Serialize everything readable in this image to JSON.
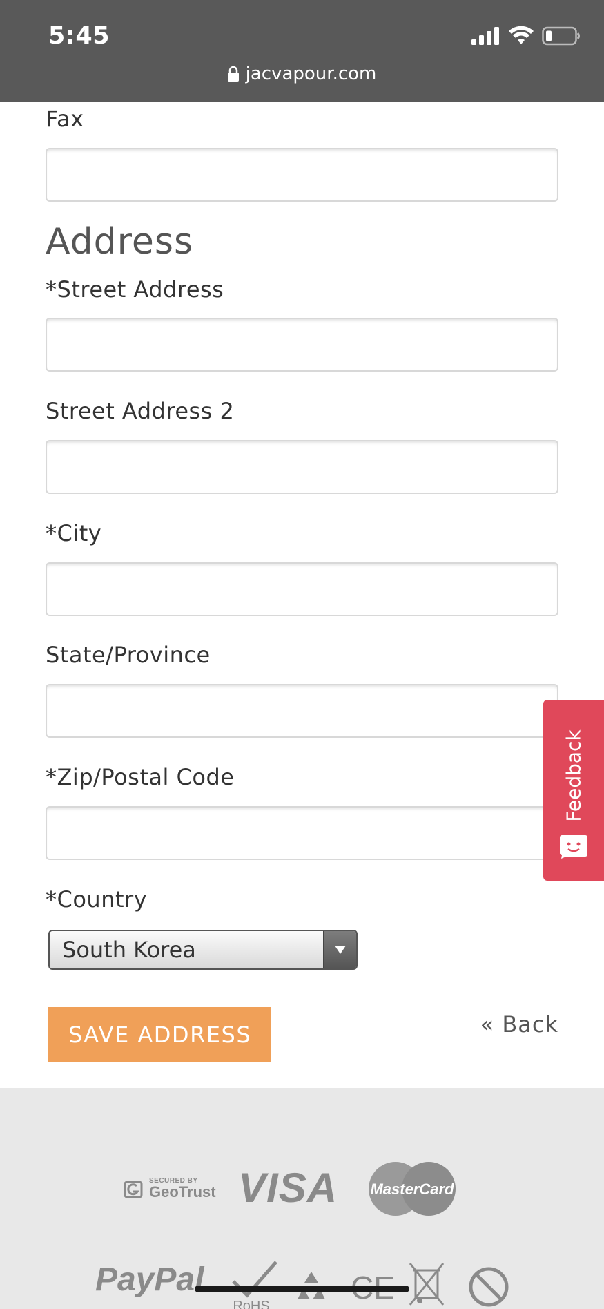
{
  "status": {
    "time": "5:45",
    "url": "jacvapour.com"
  },
  "form": {
    "fax_label": "Fax",
    "address_heading": "Address",
    "street_label": "*Street Address",
    "street2_label": "Street Address 2",
    "city_label": "*City",
    "state_label": "State/Province",
    "zip_label": "*Zip/Postal Code",
    "country_label": "*Country",
    "country_value": "South Korea",
    "save_label": "SAVE ADDRESS",
    "back_label": "« Back"
  },
  "feedback": {
    "label": "Feedback"
  },
  "footer": {
    "geotrust_small": "SECURED BY",
    "geotrust_name": "GeoTrust",
    "visa": "VISA",
    "mastercard": "MasterCard",
    "paypal": "PayPal",
    "rohs": "RoHS",
    "ce": "CE"
  },
  "colors": {
    "status_bar": "#595959",
    "save_button": "#f0a058",
    "feedback": "#e0485a",
    "footer_bg": "#e8e8e8"
  }
}
